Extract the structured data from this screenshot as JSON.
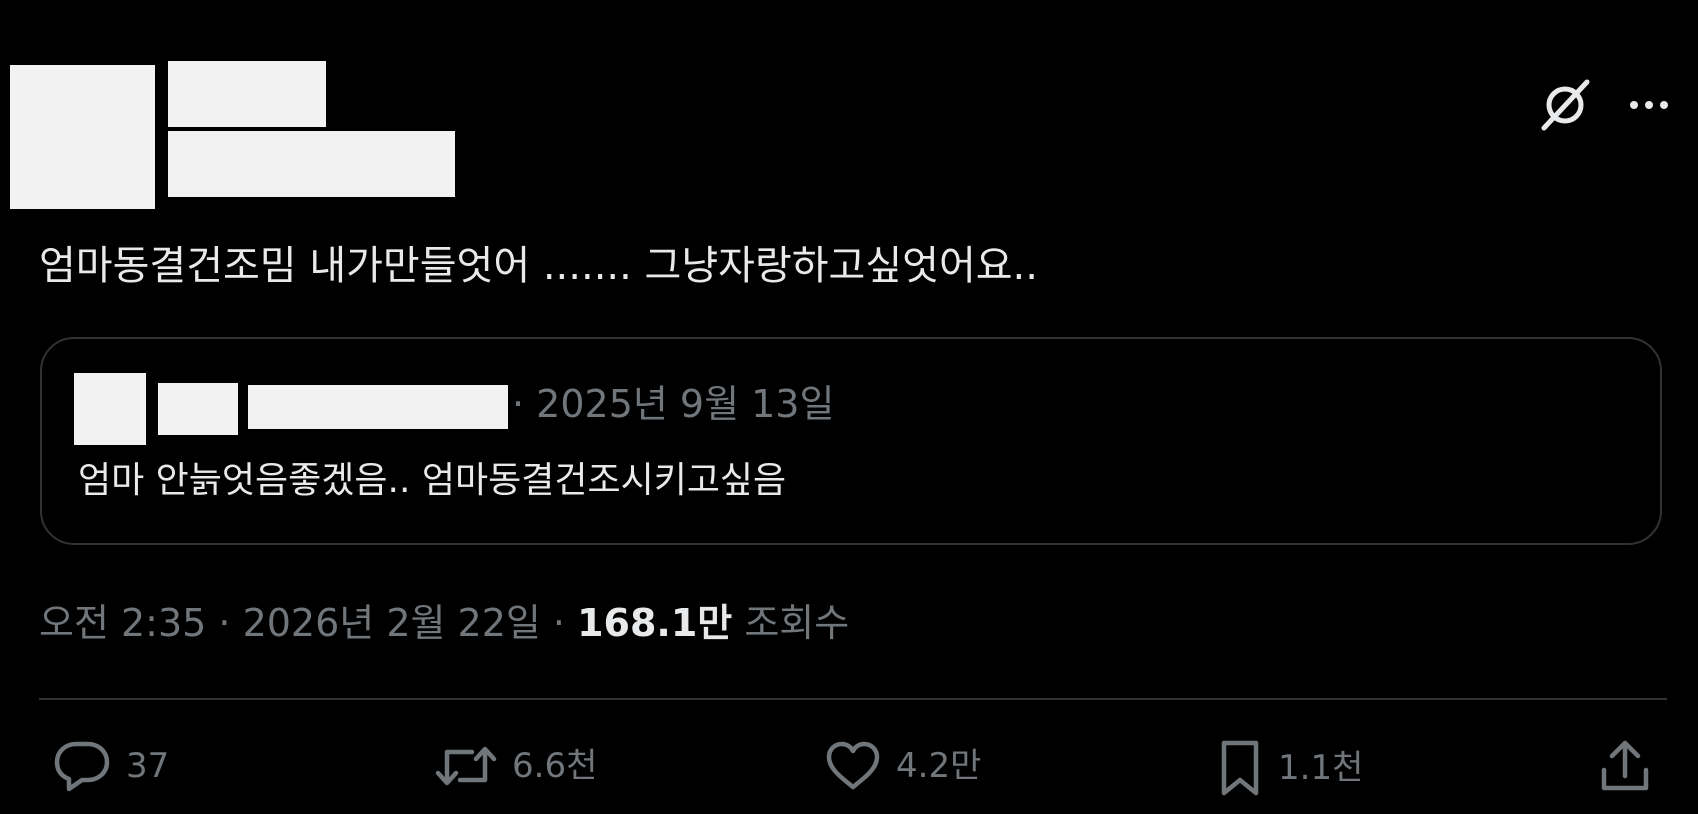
{
  "post": {
    "text": "엄마동결건조밈 내가만들엇어 ....... 그냥자랑하고싶엇어요..",
    "time_date": "오전 2:35 · 2026년 2월 22일 · ",
    "views_count": "168.1만",
    "views_label": " 조회수"
  },
  "quote": {
    "date": "· 2025년 9월 13일",
    "text": "엄마 안늙엇음좋겠음.. 엄마동결건조시키고싶음"
  },
  "actions": {
    "replies": "37",
    "reposts": "6.6천",
    "likes": "4.2만",
    "bookmarks": "1.1천"
  },
  "icons": {
    "top": [
      "grok-icon",
      "more-icon"
    ],
    "actions": [
      "reply-icon",
      "repost-icon",
      "like-icon",
      "bookmark-icon",
      "share-icon"
    ]
  },
  "colors": {
    "background": "#000000",
    "text": "#e7e9ea",
    "secondary_text": "#71767b",
    "border": "#2f3336",
    "redaction": "#f2f2f2"
  }
}
